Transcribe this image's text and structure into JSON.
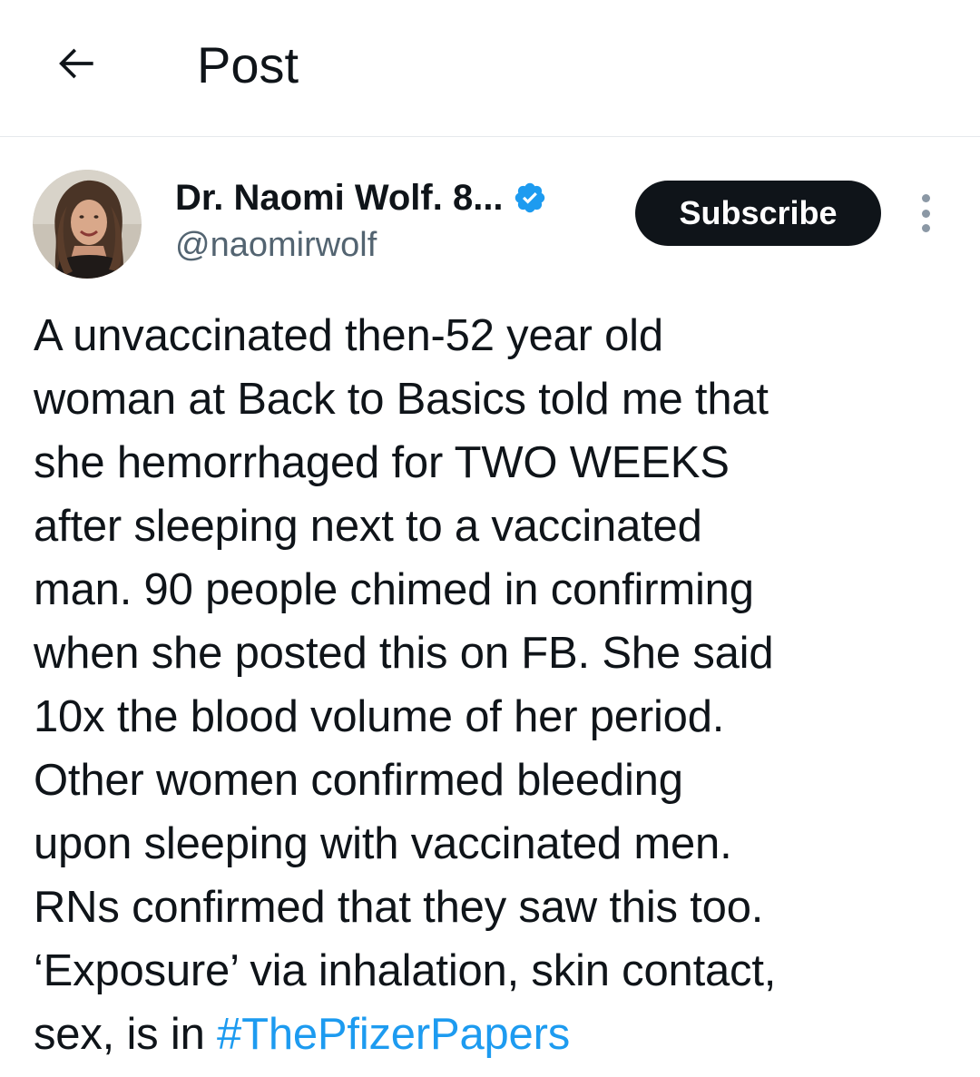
{
  "header": {
    "title": "Post",
    "back_icon": "arrow-left-icon"
  },
  "author": {
    "name": "Dr. Naomi Wolf. 8...",
    "handle": "@naomirwolf",
    "verified": true,
    "verified_icon": "verified-badge-icon",
    "verified_color": "#1d9bf0"
  },
  "actions": {
    "subscribe_label": "Subscribe",
    "more_icon": "more-vertical-icon"
  },
  "post": {
    "lines": [
      "A unvaccinated then-52 year old",
      "woman at Back to Basics told me that",
      "she hemorrhaged for TWO WEEKS",
      "after sleeping next to a vaccinated",
      "man. 90 people chimed in confirming",
      "when she posted this on FB. She said",
      "10x the blood volume of her period.",
      "Other women confirmed bleeding",
      "upon sleeping with vaccinated men.",
      "RNs confirmed that they saw this too.",
      "‘Exposure’ via inhalation, skin contact,"
    ],
    "last_line_prefix": "sex, is in ",
    "hashtag": "#ThePfizerPapers",
    "hashtag_color": "#1d9bf0"
  }
}
